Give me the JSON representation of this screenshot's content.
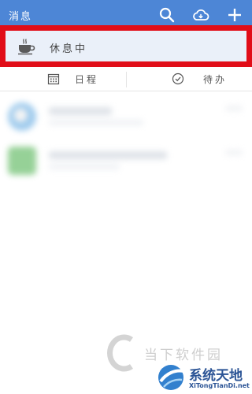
{
  "header": {
    "title": "消息",
    "icons": [
      "search-icon",
      "cloud-sync-icon",
      "plus-icon"
    ]
  },
  "status": {
    "icon": "coffee-cup-icon",
    "label": "休息中",
    "highlight_color": "#e10d18"
  },
  "tabs": [
    {
      "icon": "calendar-icon",
      "label": "日程"
    },
    {
      "icon": "check-circle-icon",
      "label": "待办"
    }
  ],
  "watermark": {
    "brand": "当下软件园",
    "site_name": "系统天地",
    "site_url": "XiTongTianDi.net"
  },
  "colors": {
    "header": "#4d86d6",
    "status_bg": "#eaf0f9",
    "highlight": "#e10d18"
  }
}
